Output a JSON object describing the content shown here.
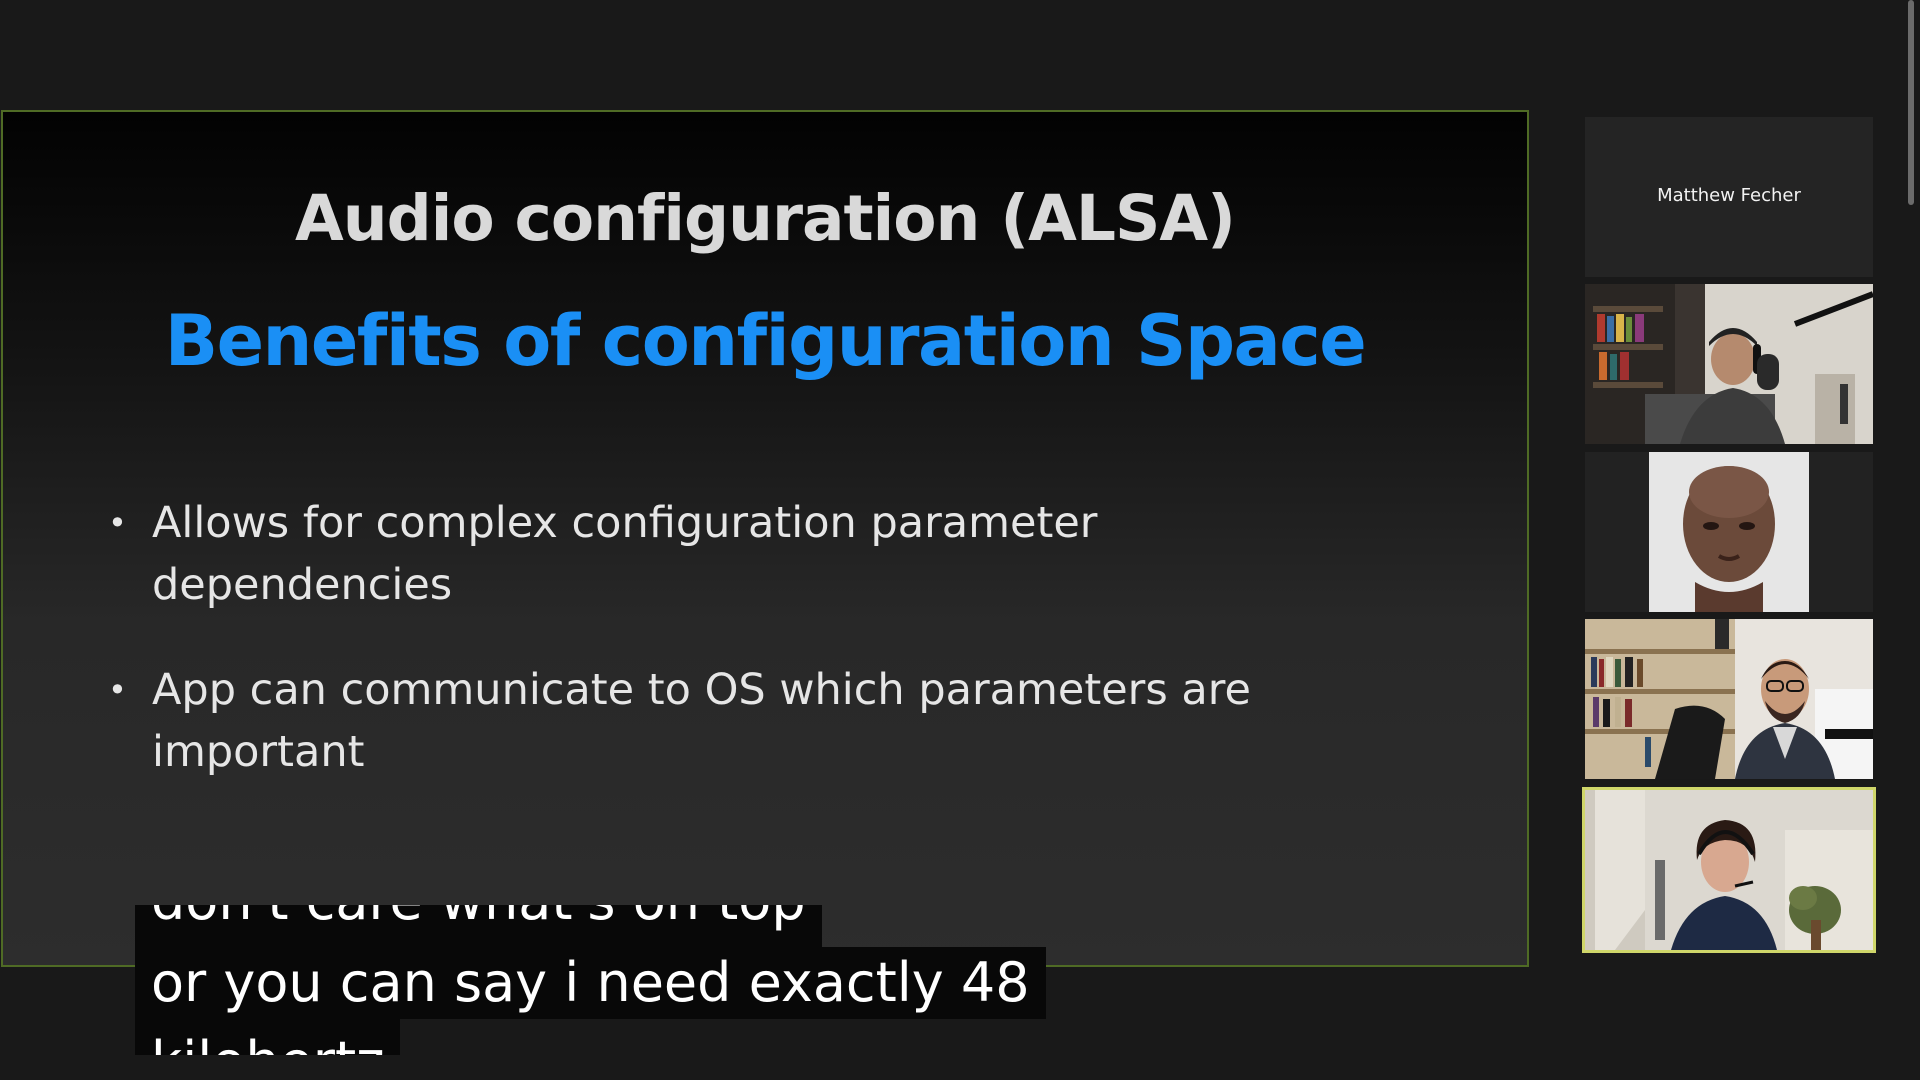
{
  "slide": {
    "title": "Audio configuration (ALSA)",
    "subtitle": "Benefits of configuration Space",
    "bullets": [
      {
        "marker": "•",
        "line1": "Allows for complex configuration parameter",
        "line2": "dependencies"
      },
      {
        "marker": "•",
        "line1": "App can communicate to OS which parameters are",
        "line2": "important"
      }
    ]
  },
  "captions": {
    "line1": "don't care what's on top",
    "line2": "or you can say i need exactly 48",
    "line3": "kilohertz"
  },
  "participants": {
    "tiles": [
      {
        "name": "Matthew Fecher"
      }
    ]
  },
  "colors": {
    "slide_border": "#4f6b25",
    "subtitle": "#1a8ff5",
    "active_speaker_border": "#cfd66a"
  }
}
